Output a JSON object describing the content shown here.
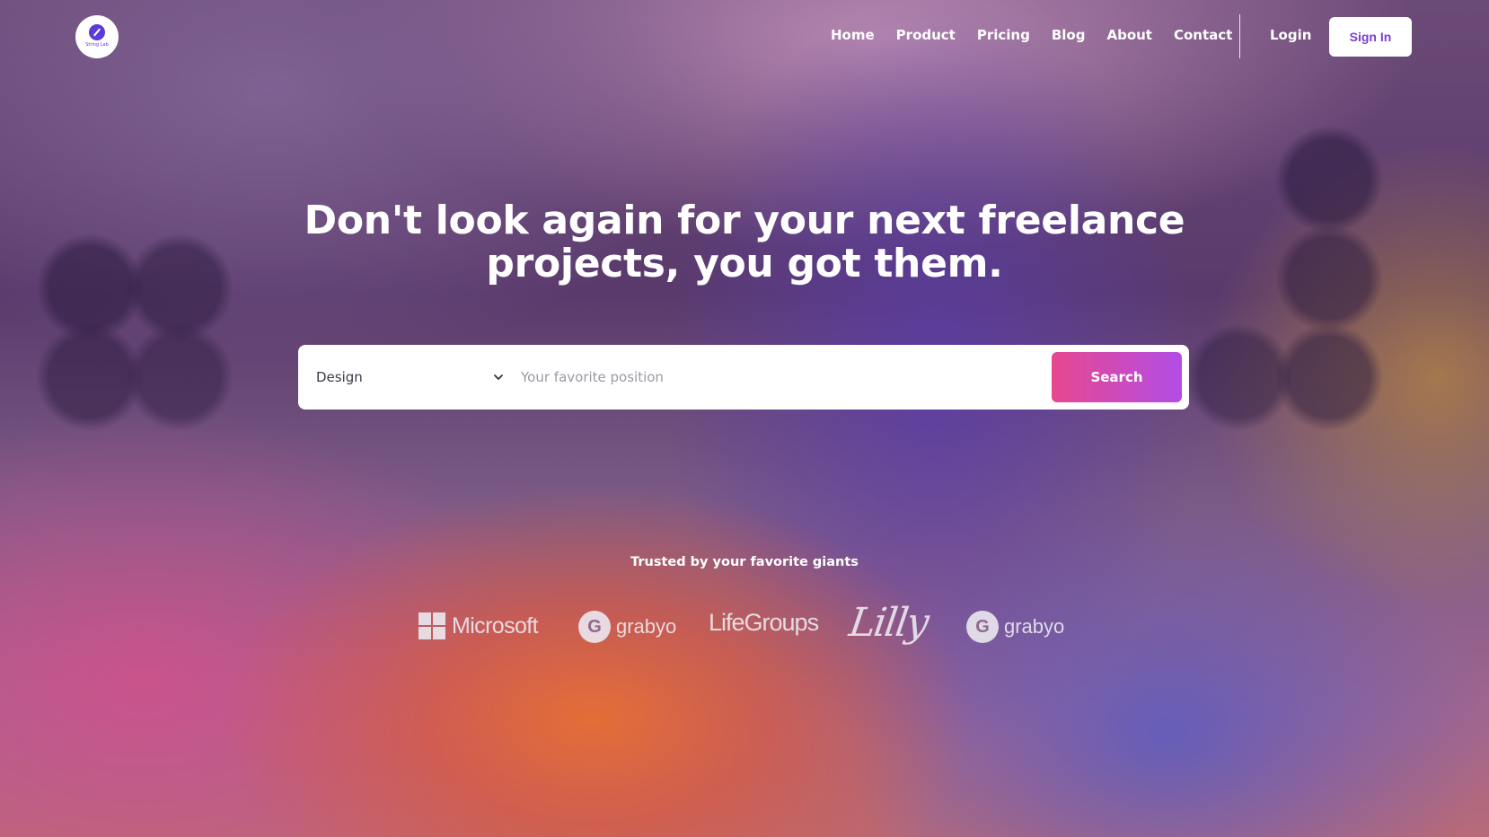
{
  "header": {
    "logo_text": "String Lab",
    "nav": [
      "Home",
      "Product",
      "Pricing",
      "Blog",
      "About",
      "Contact"
    ],
    "login_label": "Login",
    "signin_label": "Sign In"
  },
  "hero": {
    "title_line1": "Don't look again for your next freelance",
    "title_line2": "projects, you got them."
  },
  "search": {
    "category_value": "Design",
    "placeholder": "Your favorite position",
    "button_label": "Search"
  },
  "trusted": {
    "label": "Trusted by your favorite giants",
    "brands": [
      "Microsoft",
      "grabyo",
      "LifeGroups",
      "Lilly",
      "grabyo"
    ]
  },
  "colors": {
    "accent_start": "#e8478f",
    "accent_end": "#b24de6",
    "signin_text": "#7a3fd0"
  }
}
